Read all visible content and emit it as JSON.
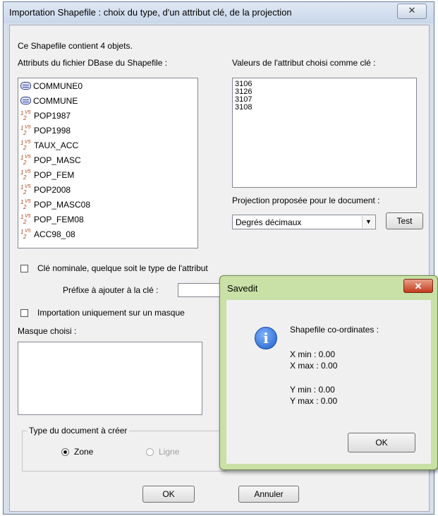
{
  "main_dialog": {
    "title": "Importation Shapefile : choix du type, d'un attribut clé, de la projection",
    "close_glyph": "✕",
    "object_count_text": "Ce Shapefile contient 4 objets.",
    "attributes_label": "Attributs du fichier DBase du Shapefile :",
    "attributes": [
      {
        "name": "COMMUNE0",
        "icon": "table-icon"
      },
      {
        "name": "COMMUNE",
        "icon": "table-icon"
      },
      {
        "name": "POP1987",
        "icon": "numeric-field-icon"
      },
      {
        "name": "POP1998",
        "icon": "numeric-field-icon"
      },
      {
        "name": "TAUX_ACC",
        "icon": "numeric-field-icon"
      },
      {
        "name": "POP_MASC",
        "icon": "numeric-field-icon"
      },
      {
        "name": "POP_FEM",
        "icon": "numeric-field-icon"
      },
      {
        "name": "POP2008",
        "icon": "numeric-field-icon"
      },
      {
        "name": "POP_MASC08",
        "icon": "numeric-field-icon"
      },
      {
        "name": "POP_FEM08",
        "icon": "numeric-field-icon"
      },
      {
        "name": "ACC98_08",
        "icon": "numeric-field-icon"
      }
    ],
    "key_values_label": "Valeurs de l'attribut choisi comme clé :",
    "key_values": [
      "3106",
      "3126",
      "3107",
      "3108"
    ],
    "projection_label": "Projection proposée pour le document :",
    "projection_value": "Degrés décimaux",
    "test_button": "Test",
    "nominal_key_label": "Clé nominale, quelque soit le type de l'attribut",
    "prefix_label": "Préfixe à ajouter à la clé :",
    "prefix_value": "",
    "mask_only_label": "Importation uniquement sur un masque",
    "mask_label": "Masque choisi :",
    "doc_type_group": "Type du document à créer",
    "doc_type_zone": "Zone",
    "doc_type_ligne": "Ligne",
    "ok_button": "OK",
    "cancel_button": "Annuler"
  },
  "overlay_dialog": {
    "title": "Savedit",
    "close_glyph": "✕",
    "heading": "Shapefile co-ordinates :",
    "xmin": "X min : 0.00",
    "xmax": "X max : 0.00",
    "ymin": "Y min : 0.00",
    "ymax": "Y max : 0.00",
    "ok_button": "OK",
    "info_glyph": "i"
  },
  "colors": {
    "title_bar": "#c9d7ea",
    "overlay_frame": "#c9e1a6",
    "close_red": "#c43c1c",
    "info_blue": "#1f5cc8"
  }
}
